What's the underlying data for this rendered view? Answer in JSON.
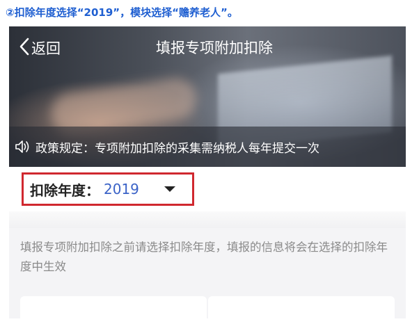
{
  "caption": "②扣除年度选择“2019”，模块选择“赡养老人”。",
  "nav": {
    "back_label": "返回",
    "title": "填报专项附加扣除"
  },
  "notice": {
    "text": "政策规定：专项附加扣除的采集需纳税人每年提交一次",
    "icon": "speaker-icon"
  },
  "year_selector": {
    "label": "扣除年度：",
    "value": "2019",
    "icon": "dropdown-caret-icon",
    "highlight_color": "#d0282f",
    "value_color": "#3a62c7"
  },
  "info": {
    "text": "填报专项附加扣除之前请选择扣除年度，填报的信息将会在选择的扣除年度中生效"
  },
  "colors": {
    "caption": "#1f5fd1",
    "info_text": "#8a8a8a",
    "panel_bg": "#f4f4f6"
  }
}
